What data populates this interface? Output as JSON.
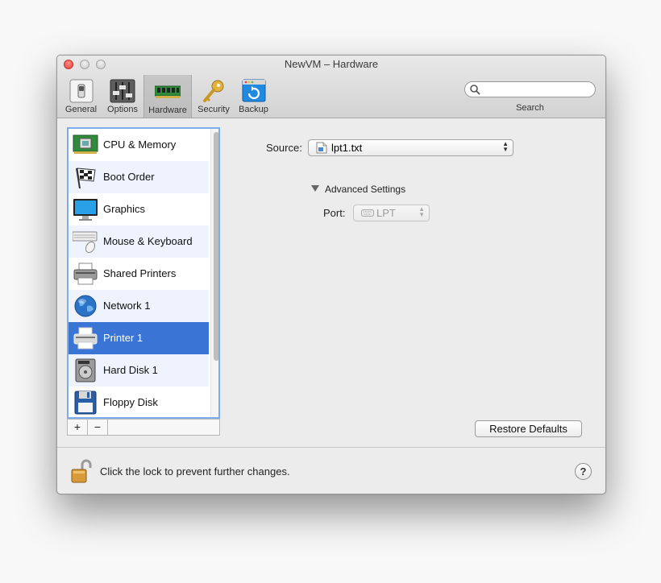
{
  "window": {
    "title": "NewVM – Hardware"
  },
  "toolbar": {
    "items": [
      {
        "label": "General",
        "icon": "switch-icon"
      },
      {
        "label": "Options",
        "icon": "sliders-icon"
      },
      {
        "label": "Hardware",
        "icon": "memory-chip-icon",
        "selected": true
      },
      {
        "label": "Security",
        "icon": "key-icon"
      },
      {
        "label": "Backup",
        "icon": "backup-icon"
      }
    ],
    "search": {
      "placeholder": "",
      "caption": "Search"
    }
  },
  "sidebar": {
    "items": [
      {
        "label": "CPU & Memory",
        "icon": "cpu-memory-icon"
      },
      {
        "label": "Boot Order",
        "icon": "checkered-flag-icon"
      },
      {
        "label": "Graphics",
        "icon": "monitor-icon"
      },
      {
        "label": "Mouse & Keyboard",
        "icon": "keyboard-mouse-icon"
      },
      {
        "label": "Shared Printers",
        "icon": "printer-icon"
      },
      {
        "label": "Network 1",
        "icon": "globe-icon"
      },
      {
        "label": "Printer 1",
        "icon": "printer-icon",
        "selected": true
      },
      {
        "label": "Hard Disk 1",
        "icon": "hard-disk-icon"
      },
      {
        "label": "Floppy Disk",
        "icon": "floppy-disk-icon"
      }
    ],
    "add_label": "+",
    "remove_label": "−"
  },
  "main": {
    "source_label": "Source:",
    "source_value": "lpt1.txt",
    "advanced_label": "Advanced Settings",
    "port_label": "Port:",
    "port_value": "LPT",
    "restore_label": "Restore Defaults"
  },
  "footer": {
    "lock_text": "Click the lock to prevent further changes.",
    "help_label": "?"
  },
  "colors": {
    "selection": "#3a75d6",
    "alt_row": "#eef3fd",
    "focus_ring": "#7aaef0",
    "close_button": "#e0443e"
  }
}
